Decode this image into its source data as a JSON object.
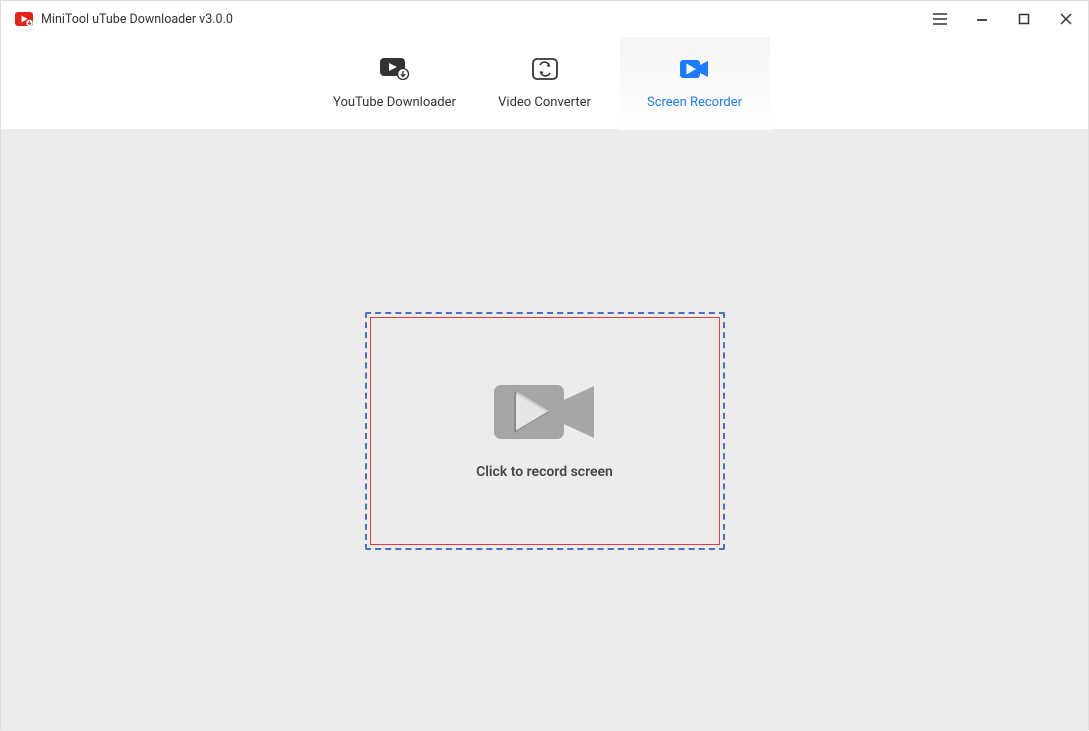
{
  "titlebar": {
    "title": "MiniTool uTube Downloader v3.0.0"
  },
  "tabs": {
    "items": [
      {
        "label": "YouTube Downloader",
        "active": false
      },
      {
        "label": "Video Converter",
        "active": false
      },
      {
        "label": "Screen Recorder",
        "active": true
      }
    ]
  },
  "main": {
    "record_prompt": "Click to record screen"
  }
}
